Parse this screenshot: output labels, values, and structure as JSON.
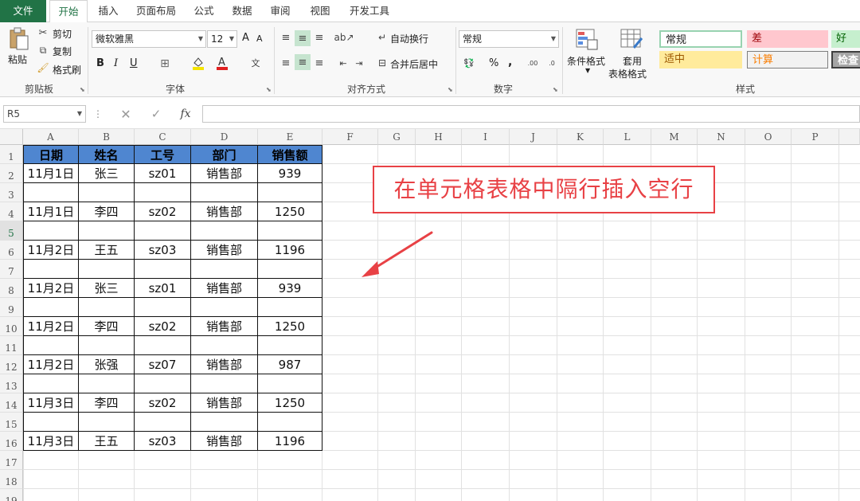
{
  "tabs": [
    "文件",
    "开始",
    "插入",
    "页面布局",
    "公式",
    "数据",
    "审阅",
    "视图",
    "开发工具"
  ],
  "active_tab": "开始",
  "ribbon": {
    "clipboard": {
      "paste": "粘贴",
      "cut": "剪切",
      "copy": "复制",
      "format_painter": "格式刷",
      "label": "剪贴板"
    },
    "font": {
      "name": "微软雅黑",
      "size": "12",
      "bold": "B",
      "italic": "I",
      "underline": "U",
      "label": "字体",
      "grow": "A",
      "shrink": "A"
    },
    "alignment": {
      "wrap_text": "自动换行",
      "merge_center": "合并后居中",
      "label": "对齐方式"
    },
    "number": {
      "format": "常规",
      "percent": "%",
      "comma": ",",
      "label": "数字"
    },
    "conditional_format": "条件格式",
    "table_format_line1": "套用",
    "table_format_line2": "表格格式",
    "styles": {
      "normal": "常规",
      "bad": "差",
      "good": "好",
      "neutral": "适中",
      "calculation": "计算",
      "check": "检查",
      "label": "样式"
    }
  },
  "name_box": "R5",
  "formula_value": "",
  "columns": [
    "A",
    "B",
    "C",
    "D",
    "E",
    "F",
    "G",
    "H",
    "I",
    "J",
    "K",
    "L",
    "M",
    "N",
    "O",
    "P"
  ],
  "rows": [
    "1",
    "2",
    "3",
    "4",
    "5",
    "6",
    "7",
    "8",
    "9",
    "10",
    "11",
    "12",
    "13",
    "14",
    "15",
    "16",
    "17",
    "18",
    "19"
  ],
  "selected_row": "5",
  "table": {
    "headers": [
      "日期",
      "姓名",
      "工号",
      "部门",
      "销售额"
    ],
    "rows": [
      [
        "11月1日",
        "张三",
        "sz01",
        "销售部",
        "939"
      ],
      [
        "",
        "",
        "",
        "",
        ""
      ],
      [
        "11月1日",
        "李四",
        "sz02",
        "销售部",
        "1250"
      ],
      [
        "",
        "",
        "",
        "",
        ""
      ],
      [
        "11月2日",
        "王五",
        "sz03",
        "销售部",
        "1196"
      ],
      [
        "",
        "",
        "",
        "",
        ""
      ],
      [
        "11月2日",
        "张三",
        "sz01",
        "销售部",
        "939"
      ],
      [
        "",
        "",
        "",
        "",
        ""
      ],
      [
        "11月2日",
        "李四",
        "sz02",
        "销售部",
        "1250"
      ],
      [
        "",
        "",
        "",
        "",
        ""
      ],
      [
        "11月2日",
        "张强",
        "sz07",
        "销售部",
        "987"
      ],
      [
        "",
        "",
        "",
        "",
        ""
      ],
      [
        "11月3日",
        "李四",
        "sz02",
        "销售部",
        "1250"
      ],
      [
        "",
        "",
        "",
        "",
        ""
      ],
      [
        "11月3日",
        "王五",
        "sz03",
        "销售部",
        "1196"
      ]
    ]
  },
  "annotation": "在单元格表格中隔行插入空行",
  "colors": {
    "accent_green": "#217346",
    "header_fill": "#4f86d0",
    "annotation_red": "#e84145"
  }
}
